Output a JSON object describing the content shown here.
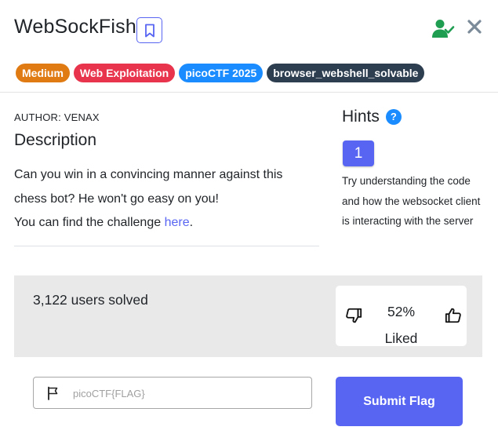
{
  "challenge": {
    "title": "WebSockFish",
    "author": "AUTHOR: VENAX"
  },
  "badges": [
    {
      "label": "Medium",
      "color": "#e07b14"
    },
    {
      "label": "Web Exploitation",
      "color": "#e8344c"
    },
    {
      "label": "picoCTF 2025",
      "color": "#1a8cff"
    },
    {
      "label": "browser_webshell_solvable",
      "color": "#2d3e50"
    }
  ],
  "description": {
    "heading": "Description",
    "line1": "Can you win in a convincing manner against this chess bot? He won't go easy on you!",
    "line2_prefix": "You can find the challenge ",
    "link_text": "here",
    "line2_suffix": "."
  },
  "hints": {
    "heading": "Hints",
    "help_icon": "?",
    "button_label": "1",
    "text": "Try understanding the code and how the websocket client is interacting with the server"
  },
  "stats": {
    "solved_text": "3,122 users solved",
    "liked_percent": "52%",
    "liked_label": "Liked"
  },
  "flag_form": {
    "placeholder": "picoCTF{FLAG}",
    "value": "",
    "submit_label": "Submit Flag"
  },
  "icons": {
    "bookmark": "bookmark-icon",
    "user_check": "user-check-icon",
    "close": "close-icon",
    "thumbs_down": "thumbs-down-icon",
    "thumbs_up": "thumbs-up-icon",
    "flag": "flag-icon"
  },
  "colors": {
    "accent": "#5865f2",
    "success": "#1f9e52",
    "close": "#7b8a98",
    "panel": "#e9e9e9"
  }
}
